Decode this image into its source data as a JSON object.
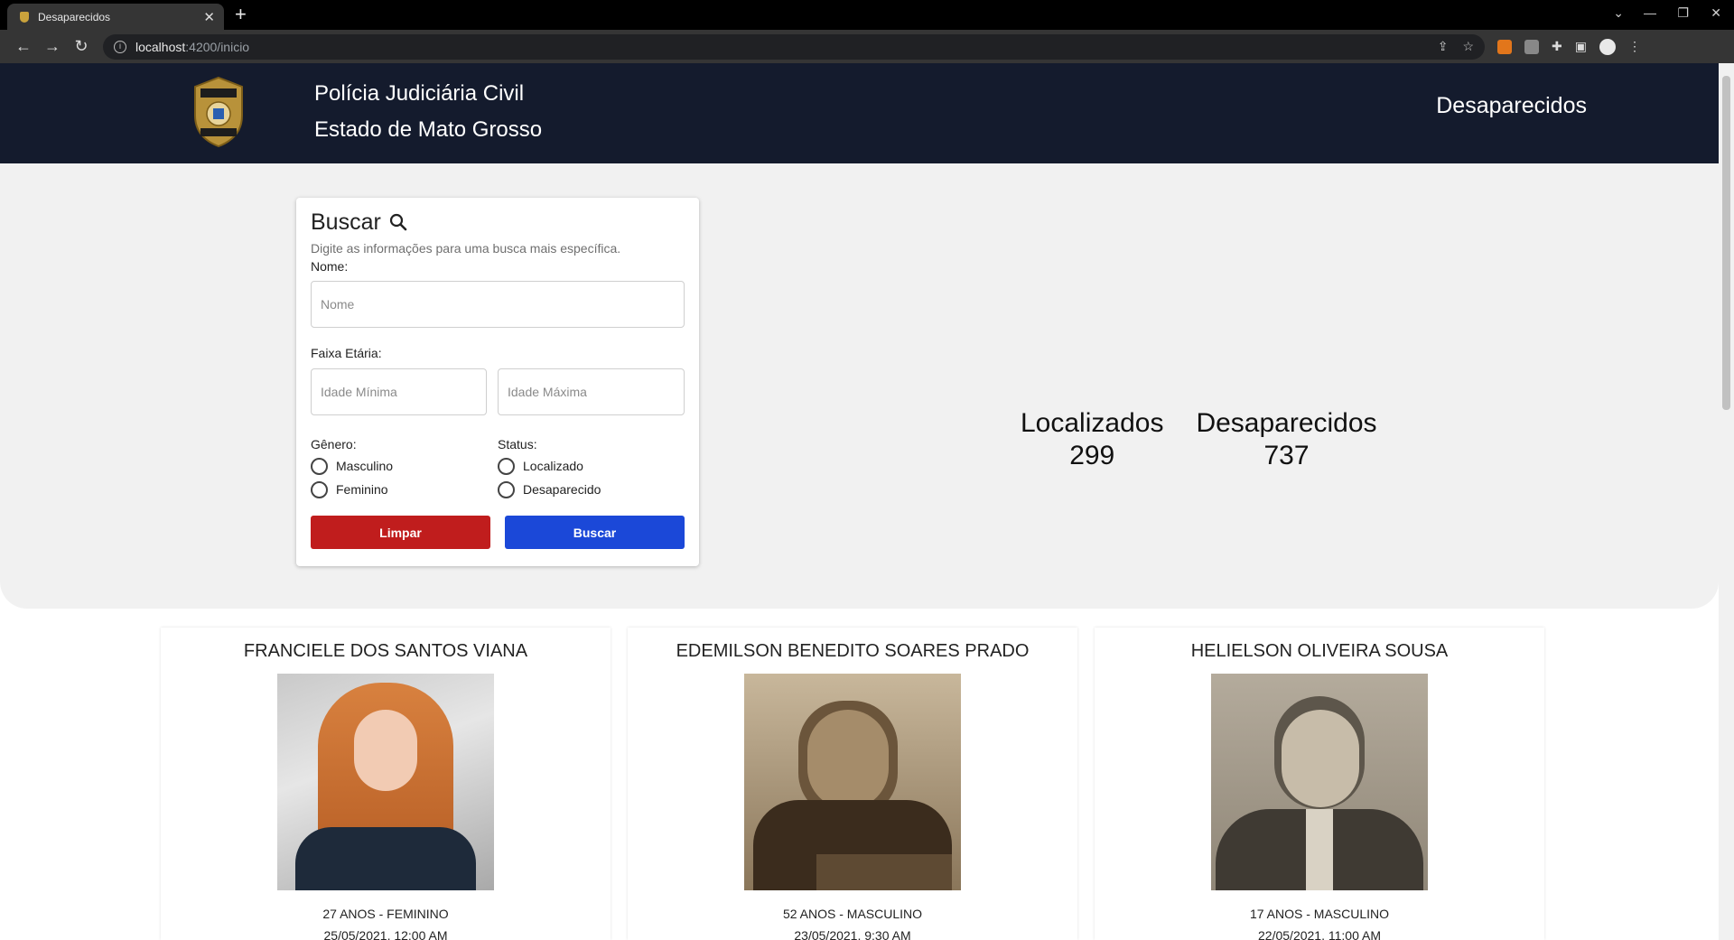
{
  "browser": {
    "tab_title": "Desaparecidos",
    "url_host": "localhost",
    "url_path": ":4200/inicio"
  },
  "header": {
    "title_line1": "Polícia Judiciária Civil",
    "title_line2": "Estado de Mato Grosso",
    "nav_link": "Desaparecidos",
    "badge_text_top": "POLÍCIA",
    "badge_text_bottom": "CIVIL",
    "badge_text_small": "MT"
  },
  "search": {
    "title": "Buscar",
    "subtitle": "Digite as informações para uma busca mais específica.",
    "name_label": "Nome:",
    "name_placeholder": "Nome",
    "age_label": "Faixa Etária:",
    "age_min_placeholder": "Idade Mínima",
    "age_max_placeholder": "Idade Máxima",
    "gender_label": "Gênero:",
    "gender_options": [
      "Masculino",
      "Feminino"
    ],
    "status_label": "Status:",
    "status_options": [
      "Localizado",
      "Desaparecido"
    ],
    "clear_button": "Limpar",
    "search_button": "Buscar"
  },
  "stats": {
    "found_label": "Localizados",
    "found_value": "299",
    "missing_label": "Desaparecidos",
    "missing_value": "737"
  },
  "people": [
    {
      "name": "FRANCIELE DOS SANTOS VIANA",
      "age_gender": "27 ANOS - FEMININO",
      "date": "25/05/2021, 12:00 AM"
    },
    {
      "name": "EDEMILSON BENEDITO SOARES PRADO",
      "age_gender": "52 ANOS - MASCULINO",
      "date": "23/05/2021, 9:30 AM"
    },
    {
      "name": "HELIELSON OLIVEIRA SOUSA",
      "age_gender": "17 ANOS - MASCULINO",
      "date": "22/05/2021, 11:00 AM"
    }
  ],
  "colors": {
    "header_bg": "#141b2d",
    "clear_button": "#c01d1d",
    "search_button": "#1b48d8"
  }
}
